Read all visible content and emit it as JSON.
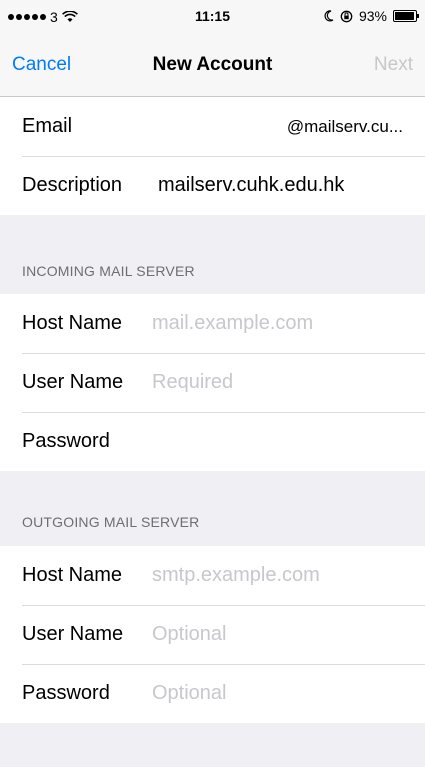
{
  "status_bar": {
    "carrier": "3",
    "time": "11:15",
    "battery_percent": "93%",
    "battery_level": 0.93
  },
  "nav": {
    "cancel_label": "Cancel",
    "title": "New Account",
    "next_label": "Next"
  },
  "account": {
    "email_label": "Email",
    "email_value": "@mailserv.cu...",
    "description_label": "Description",
    "description_value": "mailserv.cuhk.edu.hk"
  },
  "incoming": {
    "header": "INCOMING MAIL SERVER",
    "host_label": "Host Name",
    "host_placeholder": "mail.example.com",
    "user_label": "User Name",
    "user_placeholder": "Required",
    "password_label": "Password"
  },
  "outgoing": {
    "header": "OUTGOING MAIL SERVER",
    "host_label": "Host Name",
    "host_placeholder": "smtp.example.com",
    "user_label": "User Name",
    "user_placeholder": "Optional",
    "password_label": "Password",
    "password_placeholder": "Optional"
  },
  "colors": {
    "accent": "#007aff",
    "disabled": "#c7c7cc",
    "placeholder": "#c7c7cd",
    "background": "#efeff4"
  }
}
